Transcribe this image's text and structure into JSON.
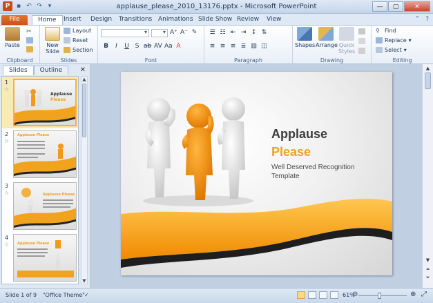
{
  "window": {
    "title": "applause_please_2010_13176.pptx - Microsoft PowerPoint",
    "app_icon": "P",
    "controls": [
      "—",
      "▢",
      "✕"
    ]
  },
  "tabs": [
    {
      "label": "File"
    },
    {
      "label": "Home"
    },
    {
      "label": "Insert"
    },
    {
      "label": "Design"
    },
    {
      "label": "Transitions"
    },
    {
      "label": "Animations"
    },
    {
      "label": "Slide Show"
    },
    {
      "label": "Review"
    },
    {
      "label": "View"
    }
  ],
  "ribbon": {
    "clipboard": {
      "label": "Clipboard",
      "paste": "Paste"
    },
    "slides": {
      "label": "Slides",
      "new_slide": "New Slide",
      "layout": "Layout",
      "reset": "Reset",
      "section": "Section"
    },
    "font": {
      "label": "Font"
    },
    "paragraph": {
      "label": "Paragraph"
    },
    "drawing": {
      "label": "Drawing",
      "shapes": "Shapes",
      "arrange": "Arrange",
      "quick_styles": "Quick Styles"
    },
    "editing": {
      "label": "Editing",
      "find": "Find",
      "replace": "Replace",
      "select": "Select"
    }
  },
  "pane": {
    "tab_slides": "Slides",
    "tab_outline": "Outline",
    "close": "✕",
    "thumbnails": [
      {
        "num": "1",
        "title": "Applause",
        "subtitle": "Please"
      },
      {
        "num": "2",
        "title": "Applause",
        "subtitle": "Please"
      },
      {
        "num": "3",
        "title": "Applause",
        "subtitle": "Please"
      },
      {
        "num": "4",
        "title": "Applause",
        "subtitle": "Please"
      }
    ]
  },
  "slide": {
    "title": "Applause",
    "accent": "Please",
    "subtitle": "Well Deserved Recognition Template"
  },
  "status": {
    "slide_info": "Slide 1 of 9",
    "theme": "\"Office Theme\"",
    "zoom": "61%",
    "zoom_fraction": 0.45
  },
  "colors": {
    "accent_orange": "#f0a020",
    "file_tab": "#d4601e",
    "ribbon_blue": "#dfe9f5"
  }
}
